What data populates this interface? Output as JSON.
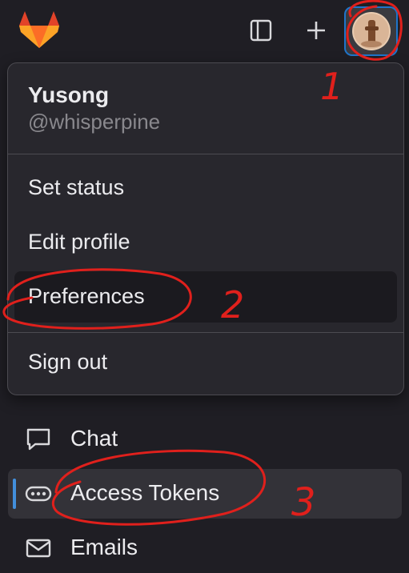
{
  "topbar": {
    "logo_icon": "gitlab-tanuki-icon",
    "sidebar_toggle_icon": "sidebar-toggle-icon",
    "new_icon": "plus-icon",
    "avatar_icon": "user-avatar"
  },
  "user_menu": {
    "name": "Yusong",
    "handle": "@whisperpine",
    "items": [
      {
        "label": "Set status"
      },
      {
        "label": "Edit profile"
      },
      {
        "label": "Preferences"
      },
      {
        "label": "Sign out"
      }
    ]
  },
  "sidebar": {
    "items": [
      {
        "label": "Chat",
        "icon": "chat-icon"
      },
      {
        "label": "Access Tokens",
        "icon": "token-icon",
        "active": true
      },
      {
        "label": "Emails",
        "icon": "mail-icon"
      }
    ]
  },
  "annotations": {
    "step1": "1",
    "step2": "2",
    "step3": "3",
    "color": "#e0201c"
  },
  "colors": {
    "background": "#1f1e24",
    "dropdown": "#28272d",
    "accent": "#1f75cb",
    "active_bar": "#428fdc"
  }
}
